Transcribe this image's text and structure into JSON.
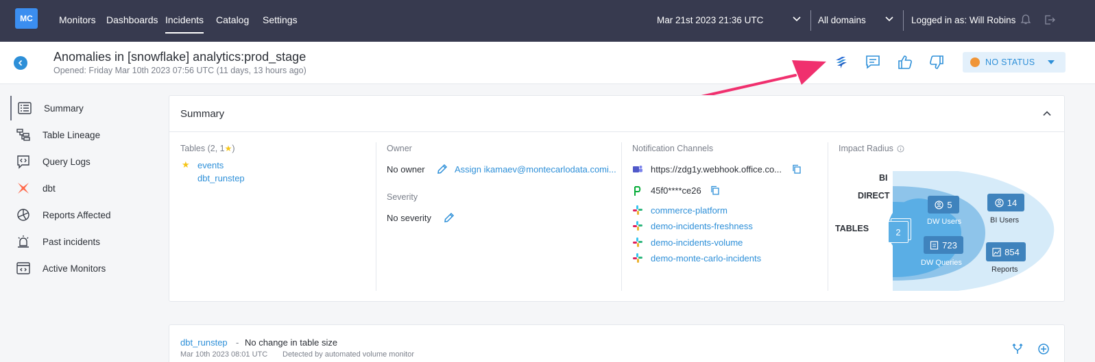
{
  "topbar": {
    "logo": "MC",
    "nav": [
      "Monitors",
      "Dashboards",
      "Incidents",
      "Catalog",
      "Settings"
    ],
    "active_nav": "Incidents",
    "date": "Mar 21st 2023 21:36 UTC",
    "domain": "All domains",
    "user": "Logged in as: Will Robins",
    "icons": [
      "bell-icon",
      "logout-icon"
    ]
  },
  "header": {
    "title": "Anomalies in [snowflake] analytics:prod_stage",
    "subtitle": "Opened: Friday Mar 10th 2023 07:56 UTC (11 days, 13 hours ago)",
    "actions": [
      "jira-icon",
      "comment-icon",
      "thumbs-up-icon",
      "thumbs-down-icon"
    ],
    "status": "NO STATUS",
    "status_color": "#f09537"
  },
  "sidebar": {
    "items": [
      {
        "label": "Summary",
        "icon": "list-icon"
      },
      {
        "label": "Table Lineage",
        "icon": "lineage-icon"
      },
      {
        "label": "Query Logs",
        "icon": "query-icon"
      },
      {
        "label": "dbt",
        "icon": "dbt-icon"
      },
      {
        "label": "Reports Affected",
        "icon": "pie-chart-icon"
      },
      {
        "label": "Past incidents",
        "icon": "alarm-icon"
      },
      {
        "label": "Active Monitors",
        "icon": "monitor-icon"
      }
    ]
  },
  "summary": {
    "title": "Summary",
    "tables": {
      "header": "Tables (2, 1 ",
      "header_end": ")",
      "items": [
        "events",
        "dbt_runstep"
      ]
    },
    "owner": {
      "header": "Owner",
      "value": "No owner",
      "assign": "Assign ikamaev@montecarlodata.comi..."
    },
    "severity": {
      "header": "Severity",
      "value": "No severity"
    },
    "notifications": {
      "header": "Notification Channels",
      "webhook": "https://zdg1y.webhook.office.co...",
      "pagerduty": "45f0****ce26",
      "slack": [
        "commerce-platform",
        "demo-incidents-freshness",
        "demo-incidents-volume",
        "demo-monte-carlo-incidents"
      ]
    },
    "impact": {
      "header": "Impact Radius",
      "levels": [
        "BI",
        "DIRECT",
        "TABLES"
      ],
      "tables_count": "2",
      "dw_users": "5",
      "dw_users_label": "DW Users",
      "dw_queries": "723",
      "dw_queries_label": "DW Queries",
      "bi_users": "14",
      "bi_users_label": "BI Users",
      "reports": "854",
      "reports_label": "Reports"
    }
  },
  "event": {
    "table": "dbt_runstep",
    "dash": "-",
    "message": "No change in table size",
    "meta_date": "Mar 10th 2023 08:01 UTC",
    "meta_detector": "Detected by automated volume monitor"
  }
}
